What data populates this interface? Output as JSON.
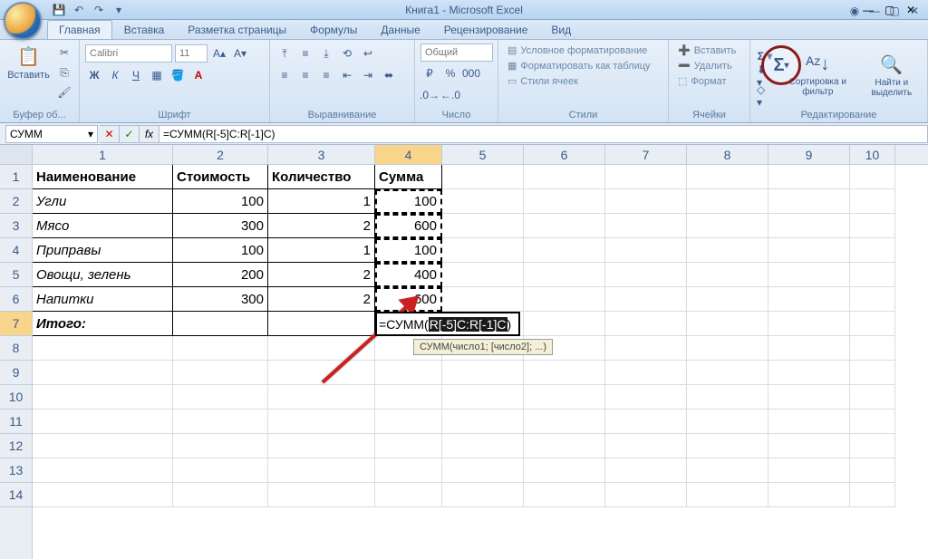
{
  "window": {
    "title": "Книга1 - Microsoft Excel"
  },
  "tabs": {
    "home": "Главная",
    "insert": "Вставка",
    "layout": "Разметка страницы",
    "formulas": "Формулы",
    "data": "Данные",
    "review": "Рецензирование",
    "view": "Вид"
  },
  "ribbon": {
    "clipboard": {
      "paste": "Вставить",
      "label": "Буфер об..."
    },
    "font": {
      "name": "Calibri",
      "size": "11",
      "label": "Шрифт"
    },
    "alignment": {
      "label": "Выравнивание"
    },
    "number": {
      "format": "Общий",
      "label": "Число"
    },
    "styles": {
      "cond": "Условное форматирование",
      "table": "Форматировать как таблицу",
      "cell": "Стили ячеек",
      "label": "Стили"
    },
    "cells": {
      "insert": "Вставить",
      "delete": "Удалить",
      "format": "Формат",
      "label": "Ячейки"
    },
    "editing": {
      "sort": "Сортировка и фильтр",
      "find": "Найти и выделить",
      "label": "Редактирование",
      "autosum": "Σ"
    }
  },
  "formula_bar": {
    "namebox": "СУММ",
    "formula": "=СУММ(R[-5]C:R[-1]C)"
  },
  "sheet": {
    "columns": [
      "1",
      "2",
      "3",
      "4",
      "5",
      "6",
      "7",
      "8",
      "9",
      "10"
    ],
    "headers": {
      "c1": "Наименование",
      "c2": "Стоимость",
      "c3": "Количество",
      "c4": "Сумма"
    },
    "rows": [
      {
        "name": "Угли",
        "cost": "100",
        "qty": "1",
        "sum": "100"
      },
      {
        "name": "Мясо",
        "cost": "300",
        "qty": "2",
        "sum": "600"
      },
      {
        "name": "Приправы",
        "cost": "100",
        "qty": "1",
        "sum": "100"
      },
      {
        "name": "Овощи, зелень",
        "cost": "200",
        "qty": "2",
        "sum": "400"
      },
      {
        "name": "Напитки",
        "cost": "300",
        "qty": "2",
        "sum": "600"
      }
    ],
    "total_label": "Итого:"
  },
  "editing": {
    "prefix": "=СУММ(",
    "selected": "R[-5]C:R[-1]C",
    "suffix": ")",
    "tooltip": "СУММ(число1; [число2]; ...)"
  }
}
